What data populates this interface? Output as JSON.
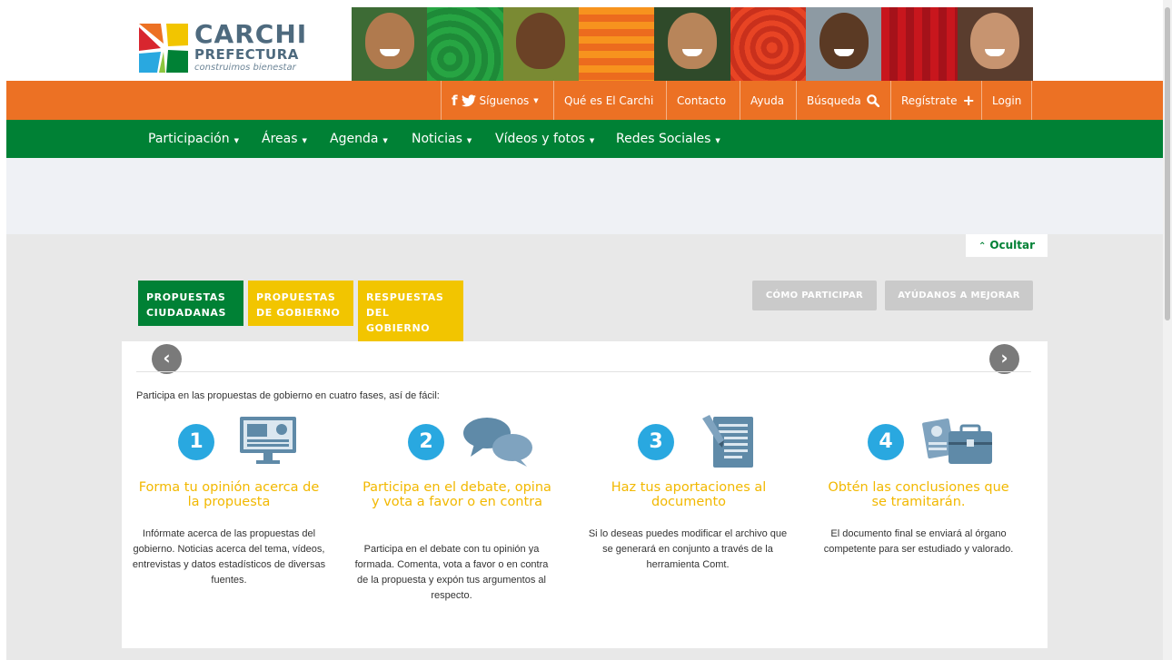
{
  "colors": {
    "orange": "#ec7124",
    "green": "#008135",
    "yellow": "#f2c500",
    "blue": "#29a8e0",
    "logo_text": "#4e6a7e"
  },
  "logo": {
    "title": "CARCHI",
    "subtitle": "PREFECTURA",
    "tagline": "construimos bienestar"
  },
  "banner": {
    "tiles": [
      "portrait",
      "green-spiral",
      "portrait",
      "orange-stripes",
      "portrait",
      "red-spiral",
      "portrait",
      "red-curtain",
      "portrait"
    ]
  },
  "top_nav": {
    "siguenos": "Síguenos",
    "que_es": "Qué es El Carchi",
    "contacto": "Contacto",
    "ayuda": "Ayuda",
    "busqueda": "Búsqueda",
    "registrate": "Regístrate",
    "login": "Login"
  },
  "main_nav": [
    "Participación",
    "Áreas",
    "Agenda",
    "Noticias",
    "Vídeos y fotos",
    "Redes Sociales"
  ],
  "hide_label": "Ocultar",
  "tabs": [
    "PROPUESTAS CIUDADANAS",
    "PROPUESTAS DE GOBIERNO",
    "RESPUESTAS DEL GOBIERNO"
  ],
  "buttons": {
    "como": "CÓMO PARTICIPAR",
    "ayudanos": "AYÚDANOS A MEJORAR"
  },
  "intro": "Participa en las propuestas de gobierno en cuatro fases, así de fácil:",
  "steps": [
    {
      "number": "1",
      "icon": "monitor-icon",
      "title": "Forma tu opinión acerca de la propuesta",
      "desc": "Infórmate acerca de las propuestas del gobierno. Noticias acerca del tema, vídeos, entrevistas y datos estadísticos de diversas fuentes."
    },
    {
      "number": "2",
      "icon": "speech-bubbles-icon",
      "title": "Participa en el debate, opina y vota a favor o en contra",
      "desc": "Participa en el debate con tu opinión ya formada. Comenta, vota a favor o en contra de la propuesta y expón tus argumentos al respecto."
    },
    {
      "number": "3",
      "icon": "document-pen-icon",
      "title": "Haz tus aportaciones al documento",
      "desc": "Si lo deseas puedes modificar el archivo que se generará en conjunto a través de la herramienta Comt."
    },
    {
      "number": "4",
      "icon": "briefcase-certificate-icon",
      "title": "Obtén las conclusiones que se tramitarán.",
      "desc": "El documento final se enviará al órgano competente para ser estudiado y valorado."
    }
  ]
}
